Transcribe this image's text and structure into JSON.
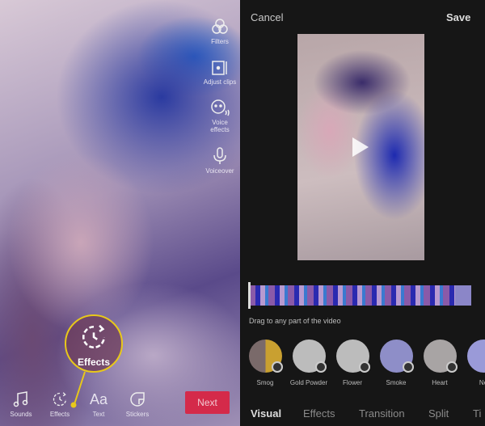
{
  "editor": {
    "side_tools": [
      {
        "label": "Filters",
        "icon": "filters-icon"
      },
      {
        "label": "Adjust clips",
        "icon": "adjust-clips-icon"
      },
      {
        "label": "Voice effects",
        "icon": "voice-effects-icon"
      },
      {
        "label": "Voiceover",
        "icon": "microphone-icon"
      }
    ],
    "bottom_tools": [
      {
        "label": "Sounds",
        "icon": "music-note-icon"
      },
      {
        "label": "Effects",
        "icon": "effects-timer-icon"
      },
      {
        "label": "Text",
        "icon": "text-aa-icon"
      },
      {
        "label": "Stickers",
        "icon": "sticker-icon"
      }
    ],
    "next_label": "Next",
    "callout_label": "Effects",
    "callout_color": "#e8c81a"
  },
  "effects_panel": {
    "cancel_label": "Cancel",
    "save_label": "Save",
    "hint": "Drag to any part of the video",
    "effects": [
      {
        "label": "Smog"
      },
      {
        "label": "Gold Powder"
      },
      {
        "label": "Flower"
      },
      {
        "label": "Smoke"
      },
      {
        "label": "Heart"
      },
      {
        "label": "Ne"
      }
    ],
    "tabs": [
      {
        "label": "Visual",
        "active": true
      },
      {
        "label": "Effects"
      },
      {
        "label": "Transition"
      },
      {
        "label": "Split"
      },
      {
        "label": "Ti"
      }
    ],
    "accent": "#d42a4a"
  }
}
